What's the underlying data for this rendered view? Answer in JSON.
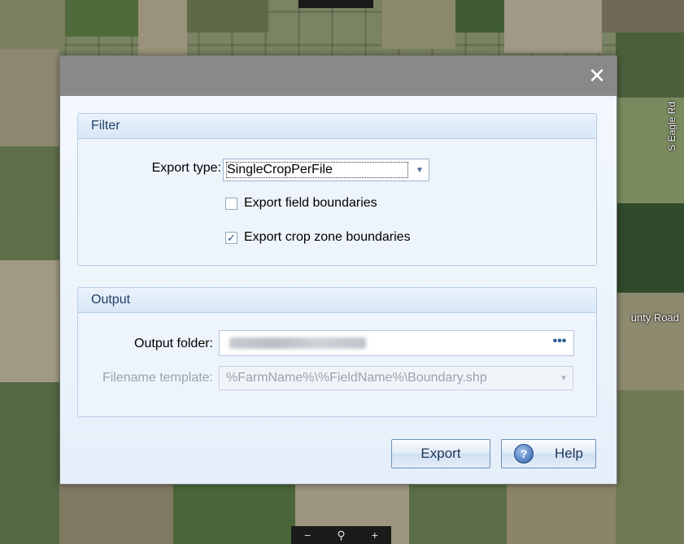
{
  "map": {
    "road_label_vertical": "S Eagle Rd",
    "road_label_horizontal": "unty Road",
    "zoom_out": "−",
    "zoom_search": "⚲",
    "zoom_in": "+"
  },
  "dialog": {
    "close_glyph": "✕",
    "filter": {
      "header": "Filter",
      "export_type_label": "Export type:",
      "export_type_value": "SingleCropPerFile",
      "export_field_boundaries_label": "Export field boundaries",
      "export_field_boundaries_checked": false,
      "export_crop_zone_boundaries_label": "Export crop zone boundaries",
      "export_crop_zone_boundaries_checked": true
    },
    "output": {
      "header": "Output",
      "output_folder_label": "Output folder:",
      "output_folder_button": "•••",
      "filename_template_label": "Filename template:",
      "filename_template_value": "%FarmName%\\%FieldName%\\Boundary.shp"
    },
    "buttons": {
      "export": "Export",
      "help": "Help",
      "help_icon_glyph": "?"
    }
  },
  "icons": {
    "dropdown_arrow": "▼",
    "checkmark": "✓"
  }
}
